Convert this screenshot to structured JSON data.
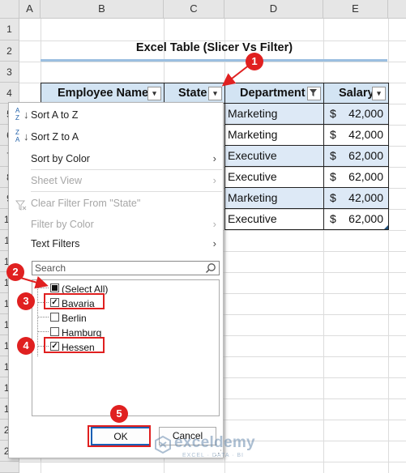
{
  "columns": [
    "A",
    "B",
    "C",
    "D",
    "E"
  ],
  "rows": [
    "1",
    "2",
    "3",
    "4",
    "5",
    "6",
    "7",
    "8",
    "9",
    "10",
    "11",
    "12",
    "13",
    "14",
    "15",
    "16",
    "17",
    "18",
    "19",
    "20",
    "21"
  ],
  "sheet_title": "Excel Table (Slicer Vs Filter)",
  "table": {
    "headers": [
      "Employee Name",
      "State",
      "Department",
      "Salary"
    ],
    "department": [
      "Marketing",
      "Marketing",
      "Executive",
      "Executive",
      "Marketing",
      "Executive"
    ],
    "currency": "$",
    "salary": [
      "42,000",
      "42,000",
      "62,000",
      "62,000",
      "42,000",
      "62,000"
    ]
  },
  "menu": {
    "sort_az": "Sort A to Z",
    "sort_za": "Sort Z to A",
    "sort_color": "Sort by Color",
    "sheet_view": "Sheet View",
    "clear_filter": "Clear Filter From \"State\"",
    "filter_color": "Filter by Color",
    "text_filters": "Text Filters",
    "search_placeholder": "Search",
    "items": [
      {
        "label": "(Select All)",
        "state": "partial"
      },
      {
        "label": "Bavaria",
        "state": "checked"
      },
      {
        "label": "Berlin",
        "state": "unchecked"
      },
      {
        "label": "Hamburg",
        "state": "unchecked"
      },
      {
        "label": "Hessen",
        "state": "checked"
      }
    ],
    "ok": "OK",
    "cancel": "Cancel"
  },
  "annotations": [
    "1",
    "2",
    "3",
    "4",
    "5"
  ],
  "watermark": {
    "name": "exceldemy",
    "tagline": "EXCEL · DATA · BI"
  },
  "colors": {
    "accent_red": "#e02020",
    "header_blue": "#d3e4f3",
    "band_blue": "#dde9f6"
  }
}
